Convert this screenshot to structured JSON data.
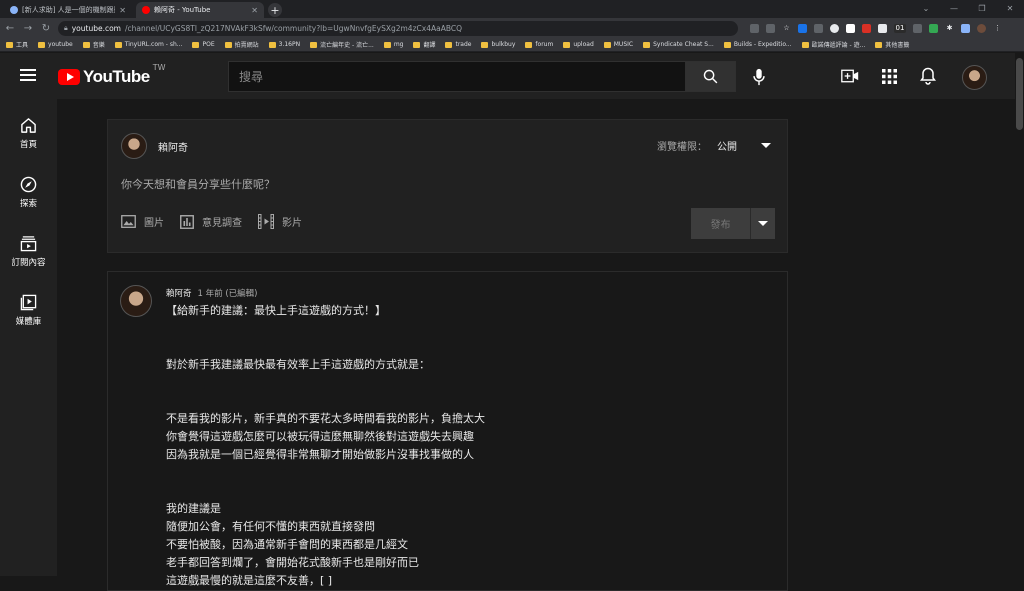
{
  "browser": {
    "tabs": [
      {
        "title": "[新人求助] 人是一個的機制跟動...",
        "active": false
      },
      {
        "title": "賴阿奇 - YouTube",
        "active": true
      }
    ],
    "url_host": "youtube.com",
    "url_path": "/channel/UCyGS8Tl_zQ217NVAkF3kSfw/community?lb=UgwNnvfgEySXg2m4zCx4AaABCQ",
    "bookmarks": [
      "工具",
      "youtube",
      "音樂",
      "TinyURL.com - sh...",
      "POE",
      "拍賣網站",
      "3.16PN",
      "流亡編年史 - 流亡...",
      "mg",
      "翻譯",
      "trade",
      "bulkbuy",
      "forum",
      "upload",
      "MUSIC",
      "Syndicate Cheat S...",
      "Builds - Expeditio...",
      "歐諾傳遞評論 - 遊...",
      "其他書籤"
    ]
  },
  "youtube": {
    "logo_text": "YouTube",
    "country_code": "TW",
    "search_placeholder": "搜尋",
    "accent_color": "#ff0000"
  },
  "sidebar": {
    "items": [
      {
        "label": "首頁",
        "icon": "home-icon"
      },
      {
        "label": "探索",
        "icon": "explore-icon"
      },
      {
        "label": "訂閱內容",
        "icon": "subscriptions-icon"
      },
      {
        "label": "媒體庫",
        "icon": "library-icon"
      }
    ]
  },
  "composer": {
    "channel_name": "賴阿奇",
    "visibility_label": "瀏覽權限：",
    "visibility_value": "公開",
    "prompt": "你今天想和會員分享些什麼呢？",
    "tools": [
      {
        "label": "圖片",
        "icon": "image-icon"
      },
      {
        "label": "意見調查",
        "icon": "poll-icon"
      },
      {
        "label": "影片",
        "icon": "video-icon"
      }
    ],
    "publish_label": "發布"
  },
  "post": {
    "author": "賴阿奇",
    "time": "1 年前 (已編輯)",
    "lines": [
      "【給新手的建議：最快上手這遊戲的方式！】",
      "",
      "",
      "對於新手我建議最快最有效率上手這遊戲的方式就是：",
      "",
      "",
      "不是看我的影片，新手真的不要花太多時間看我的影片，負擔太大",
      "你會覺得這遊戲怎麼可以被玩得這麼無聊然後對這遊戲失去興趣",
      "因為我就是一個已經覺得非常無聊才開始做影片沒事找事做的人",
      "",
      "",
      "我的建議是",
      "隨便加公會，有任何不懂的東西就直接發問",
      "不要怕被酸，因為通常新手會問的東西都是几經文",
      "老手都回答到爛了，會開始花式酸新手也是剛好而已",
      "這遊戲最慢的就是這麼不友善，[ ]"
    ]
  }
}
